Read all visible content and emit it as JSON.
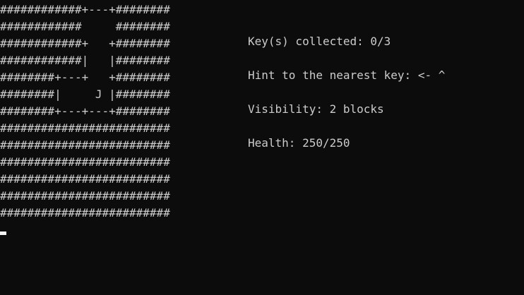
{
  "map": {
    "rows": [
      "############+---+########",
      "############     ########",
      "############+   +########",
      "############|   |########",
      "########+---+   +########",
      "########|     J |########",
      "########+---+---+########",
      "#########################",
      "#########################",
      "#########################",
      "#########################",
      "#########################",
      "#########################"
    ]
  },
  "status": {
    "keys": "Key(s) collected: 0/3",
    "hint": "Hint to the nearest key: <- ^",
    "visibility": "Visibility: 2 blocks",
    "health": "Health: 250/250"
  },
  "colors": {
    "background": "#0c0c0c",
    "text": "#cccccc",
    "cursor": "#f2f2f2"
  }
}
